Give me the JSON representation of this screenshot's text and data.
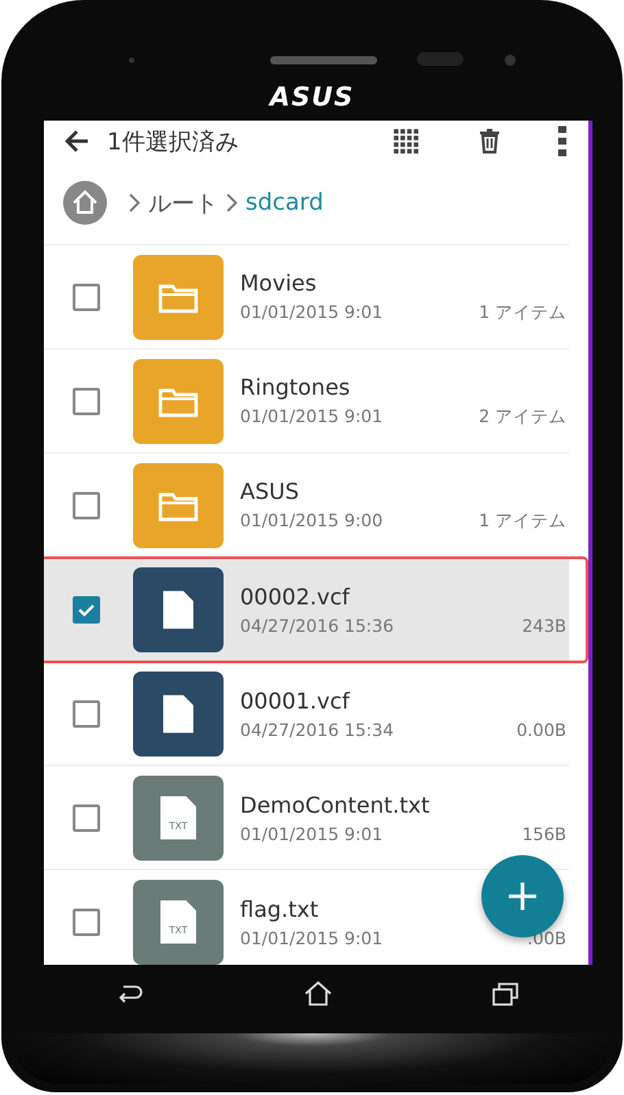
{
  "device": {
    "brand": "ASUS"
  },
  "action_bar": {
    "title": "1件選択済み"
  },
  "breadcrumb": [
    {
      "label": "ルート",
      "selected": false
    },
    {
      "label": "sdcard",
      "selected": true
    }
  ],
  "files": [
    {
      "kind": "folder",
      "name": "Movies",
      "date": "01/01/2015 9:01",
      "size": "1 アイテム",
      "checked": false,
      "highlighted": false
    },
    {
      "kind": "folder",
      "name": "Ringtones",
      "date": "01/01/2015 9:01",
      "size": "2 アイテム",
      "checked": false,
      "highlighted": false
    },
    {
      "kind": "folder",
      "name": "ASUS",
      "date": "01/01/2015 9:00",
      "size": "1 アイテム",
      "checked": false,
      "highlighted": false
    },
    {
      "kind": "document",
      "name": "00002.vcf",
      "date": "04/27/2016 15:36",
      "size": "243B",
      "checked": true,
      "highlighted": true
    },
    {
      "kind": "document",
      "name": "00001.vcf",
      "date": "04/27/2016 15:34",
      "size": "0.00B",
      "checked": false,
      "highlighted": false
    },
    {
      "kind": "text",
      "icon_label": "TXT",
      "name": "DemoContent.txt",
      "date": "01/01/2015 9:01",
      "size": "156B",
      "checked": false,
      "highlighted": false
    },
    {
      "kind": "text",
      "icon_label": "TXT",
      "name": "flag.txt",
      "date": "01/01/2015 9:01",
      "size": ".00B",
      "checked": false,
      "highlighted": false
    }
  ]
}
